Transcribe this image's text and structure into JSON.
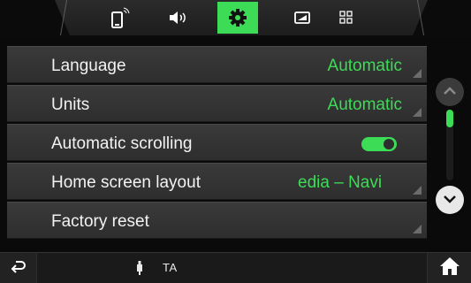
{
  "tabs": [
    {
      "name": "phone",
      "icon": "phone-icon",
      "active": false
    },
    {
      "name": "sound",
      "icon": "speaker-icon",
      "active": false
    },
    {
      "name": "settings",
      "icon": "gear-icon",
      "active": true
    },
    {
      "name": "display",
      "icon": "screen-icon",
      "active": false
    },
    {
      "name": "apps",
      "icon": "grid-icon",
      "active": false
    }
  ],
  "settings": {
    "language": {
      "label": "Language",
      "value": "Automatic"
    },
    "units": {
      "label": "Units",
      "value": "Automatic"
    },
    "auto_scroll": {
      "label": "Automatic scrolling",
      "enabled": true
    },
    "home_layout": {
      "label": "Home screen layout",
      "value": "edia – Navi"
    },
    "factory_reset": {
      "label": "Factory reset"
    }
  },
  "scroll": {
    "up_icon": "chevron-up-icon",
    "down_icon": "chevron-down-icon"
  },
  "statusbar": {
    "back_icon": "back-icon",
    "usb_icon": "usb-icon",
    "ta_label": "TA",
    "home_icon": "home-icon"
  },
  "colors": {
    "accent": "#3ddc57",
    "row_bg": "#353535",
    "background": "#0a0a0a"
  }
}
